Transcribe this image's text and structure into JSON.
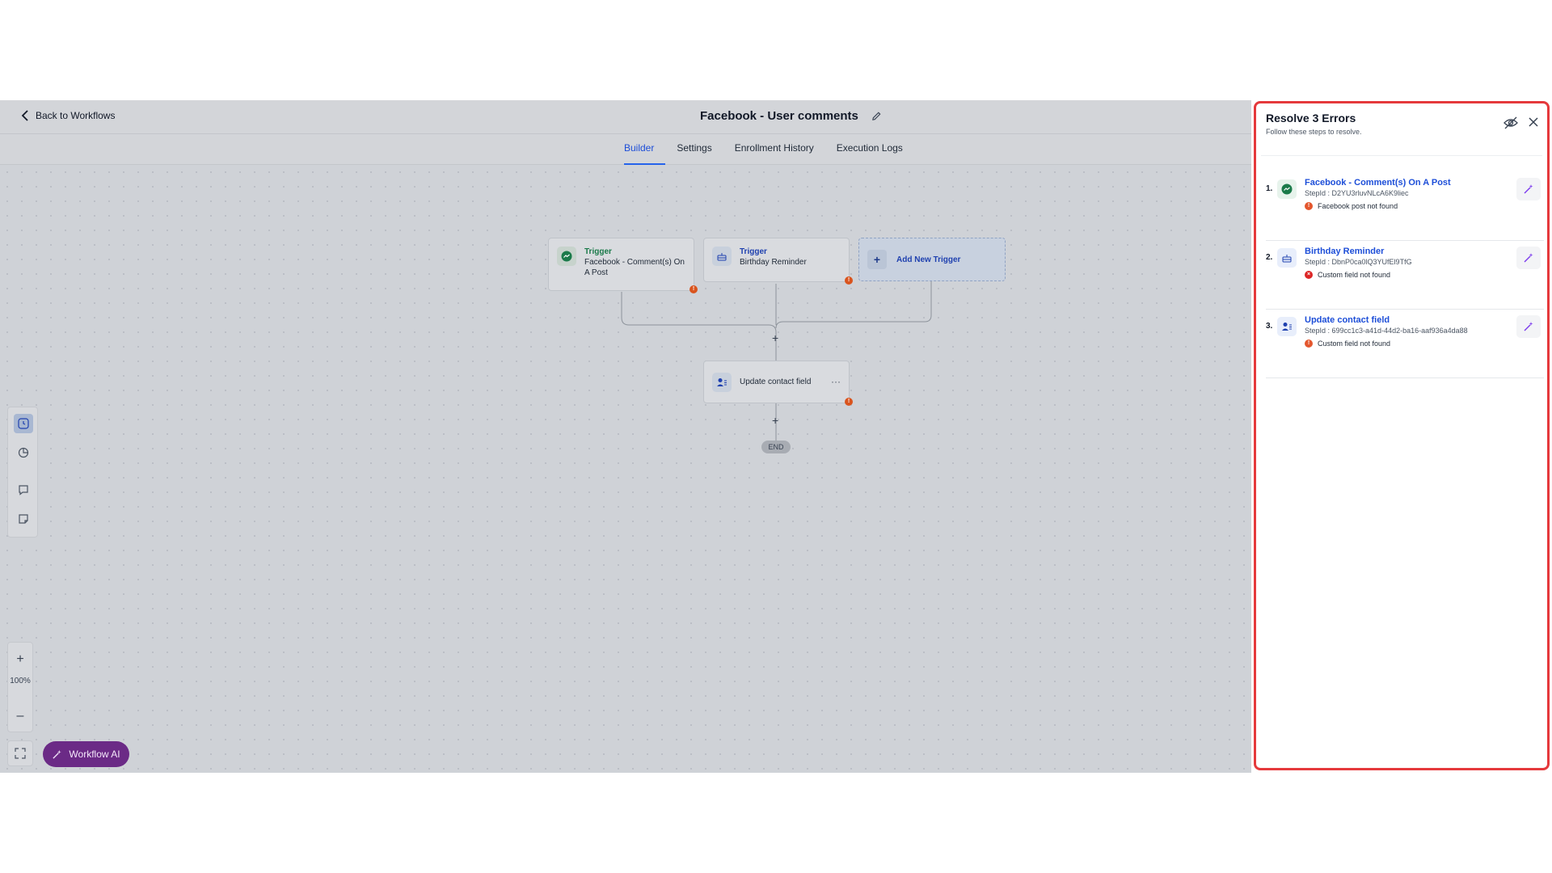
{
  "header": {
    "back_label": "Back to Workflows",
    "title": "Facebook - User comments"
  },
  "tabs": [
    {
      "label": "Builder",
      "active": true
    },
    {
      "label": "Settings",
      "active": false
    },
    {
      "label": "Enrollment History",
      "active": false
    },
    {
      "label": "Execution Logs",
      "active": false
    }
  ],
  "canvas": {
    "triggers": [
      {
        "kind": "Trigger",
        "name": "Facebook - Comment(s) On A Post",
        "icon": "facebook-messenger-icon",
        "has_error": true
      },
      {
        "kind": "Trigger",
        "name": "Birthday Reminder",
        "icon": "cake-icon",
        "has_error": true
      }
    ],
    "add_trigger_label": "Add New Trigger",
    "action": {
      "name": "Update contact field",
      "icon": "contact-update-icon",
      "has_error": true,
      "menu": "···"
    },
    "end_label": "END",
    "plus_symbol": "+"
  },
  "controls": {
    "zoom_level": "100%",
    "zoom_in": "+",
    "zoom_out": "–",
    "workflow_ai_label": "Workflow AI"
  },
  "panel": {
    "title": "Resolve 3 Errors",
    "subtitle": "Follow these steps to resolve.",
    "errors": [
      {
        "number": "1.",
        "name": "Facebook - Comment(s) On A Post",
        "step_id": "StepId : D2YU3rluvNLcA6K9liec",
        "message": "Facebook post not found",
        "severity": "warning",
        "icon": "facebook-messenger-icon"
      },
      {
        "number": "2.",
        "name": "Birthday Reminder",
        "step_id": "StepId : DbnP0ca0lQ3YUfEl9TfG",
        "message": "Custom field not found",
        "severity": "error",
        "icon": "cake-icon"
      },
      {
        "number": "3.",
        "name": "Update contact field",
        "step_id": "StepId : 699cc1c3-a41d-44d2-ba16-aaf936a4da88",
        "message": "Custom field not found",
        "severity": "warning",
        "icon": "contact-update-icon"
      }
    ]
  },
  "colors": {
    "accent": "#2563eb",
    "error_orange": "#e4572e",
    "error_red": "#dc2626",
    "highlight_border": "#e5393c",
    "ai_button": "#7b2d98"
  }
}
